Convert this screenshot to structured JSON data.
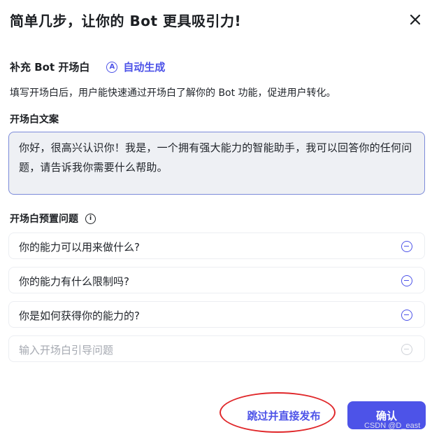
{
  "dialog": {
    "title": "简单几步，让你的 Bot 更具吸引力!"
  },
  "opening": {
    "section_title": "补充 Bot 开场白",
    "auto_generate_label": "自动生成",
    "description": "填写开场白后，用户能快速通过开场白了解你的 Bot 功能，促进用户转化。",
    "text_label": "开场白文案",
    "text_value": "你好，很高兴认识你！我是，一个拥有强大能力的智能助手，我可以回答你的任何问题，请告诉我你需要什么帮助。"
  },
  "preset_questions": {
    "label": "开场白预置问题",
    "items": [
      "你的能力可以用来做什么?",
      "你的能力有什么限制吗?",
      "你是如何获得你的能力的?"
    ],
    "new_placeholder": "输入开场白引导问题"
  },
  "footer": {
    "skip_label": "跳过并直接发布",
    "confirm_label": "确认",
    "watermark": "CSDN @D_east"
  },
  "colors": {
    "accent": "#4d53e8",
    "annotation_circle": "#e0272a"
  },
  "icons": {
    "close": "close-icon",
    "auto_generate": "auto-generate-icon",
    "info": "info-icon",
    "remove": "minus-circle-icon"
  }
}
